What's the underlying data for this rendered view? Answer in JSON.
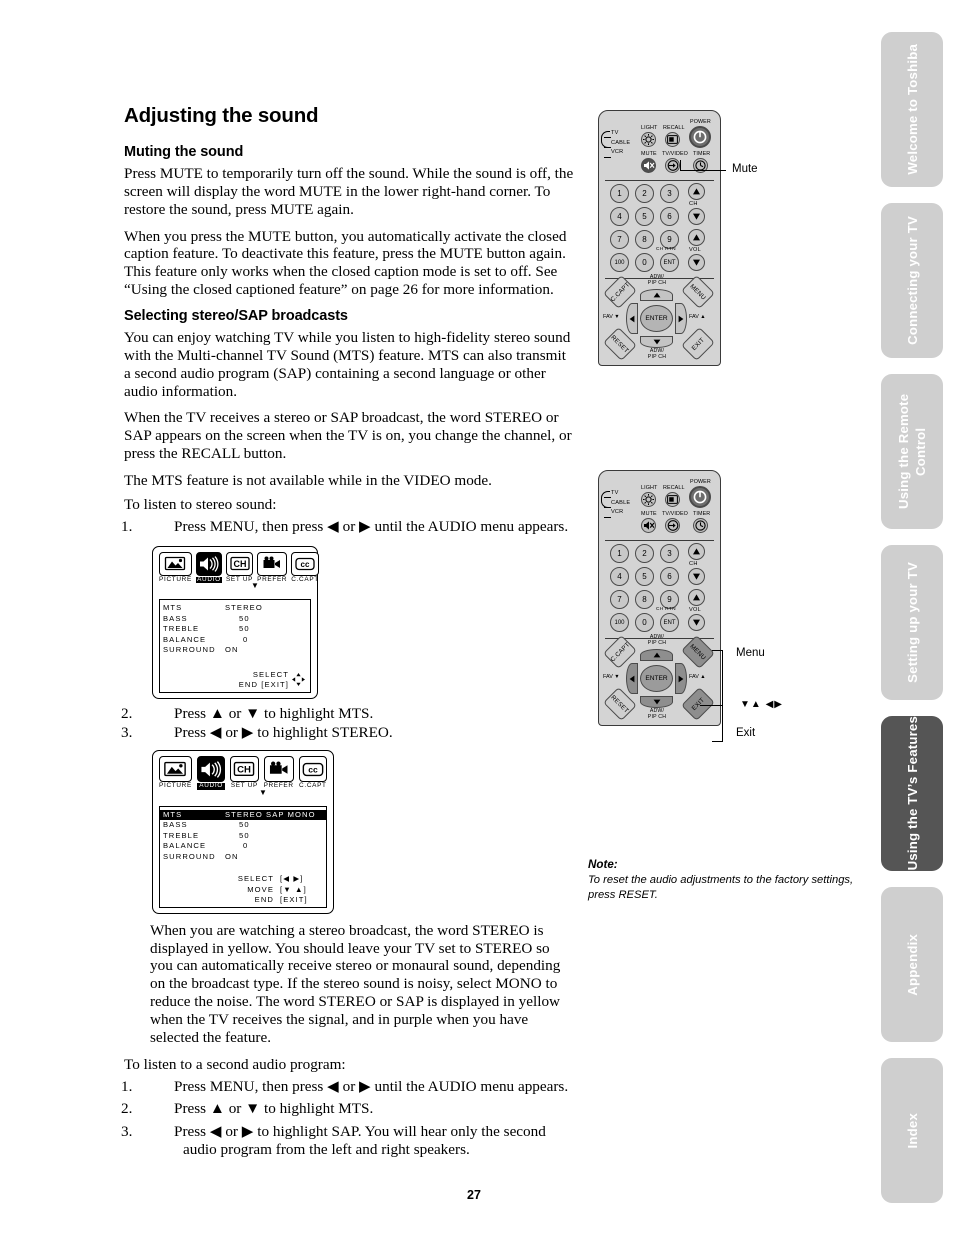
{
  "document": {
    "page_number": "27",
    "title": "Adjusting the sound"
  },
  "sections": [
    {
      "heading": "Muting the sound",
      "paragraphs": [
        "Press MUTE to temporarily turn off the sound. While the sound is off, the screen will display the word MUTE in the lower right-hand corner. To restore the sound, press MUTE again.",
        "When you press the MUTE button, you automatically activate the closed caption feature. To deactivate this feature, press the MUTE button again. This feature only works when the closed caption mode is set to off. See “Using the closed captioned feature” on page 26 for more information."
      ]
    },
    {
      "heading": "Selecting stereo/SAP broadcasts",
      "paragraphs": [
        "You can enjoy watching TV while you listen to high-fidelity stereo sound with the Multi-channel TV Sound (MTS) feature. MTS can also transmit a second audio program (SAP) containing a second language or other audio information.",
        "When the TV receives a stereo or SAP broadcast, the word STEREO or SAP appears on the screen when the TV is on, you change the channel, or press the RECALL button.",
        "The MTS feature is not available while in the VIDEO mode.",
        "To listen to stereo sound:"
      ]
    }
  ],
  "steps_stereo": [
    {
      "num": "1.",
      "text": "Press MENU, then press ◀ or ▶ until the AUDIO menu appears."
    },
    {
      "num": "2.",
      "text": "Press ▲ or ▼ to highlight MTS."
    },
    {
      "num": "3.",
      "text": "Press ◀ or ▶ to highlight STEREO."
    }
  ],
  "paragraph_stereo_note": "When you are watching a stereo broadcast, the word STEREO is displayed in yellow. You should leave your TV set to STEREO so you can automatically receive stereo or monaural sound, depending on the broadcast type. If the stereo sound is noisy, select MONO to reduce the noise. The word STEREO or SAP is displayed in yellow when the TV receives the signal, and in purple when you have selected the feature.",
  "lead_sap": "To listen to a second audio program:",
  "steps_sap": [
    {
      "num": "1.",
      "text": "Press MENU, then press ◀ or ▶ until the AUDIO menu appears."
    },
    {
      "num": "2.",
      "text": "Press ▲ or ▼ to highlight MTS."
    },
    {
      "num": "3.",
      "text": "Press ◀ or ▶ to highlight SAP. You will hear only the second audio program from the left and right speakers."
    }
  ],
  "tv_menu_1": {
    "tabs": [
      {
        "label": "PICTURE",
        "icon": "picture-icon",
        "glyph": "⛰",
        "selected": false
      },
      {
        "label": "AUDIO",
        "icon": "speaker-icon",
        "glyph": "◂)))",
        "selected": true
      },
      {
        "label": "SET UP",
        "icon": "channel-icon",
        "glyph": "CH",
        "selected": false
      },
      {
        "label": "PREFER",
        "icon": "camera-icon",
        "glyph": "▣",
        "selected": false
      },
      {
        "label": "C.CAPT",
        "icon": "closed-caption-icon",
        "glyph": "CC",
        "selected": false
      }
    ],
    "rows": [
      {
        "key": "MTS",
        "value": "STEREO",
        "highlighted": false
      },
      {
        "key": "BASS",
        "value": "50",
        "highlighted": false
      },
      {
        "key": "TREBLE",
        "value": "50",
        "highlighted": false
      },
      {
        "key": "BALANCE",
        "value": "0",
        "highlighted": false
      },
      {
        "key": "SURROUND",
        "value": "ON",
        "highlighted": false
      }
    ],
    "footer": [
      "SELECT",
      "END  [EXIT]"
    ]
  },
  "tv_menu_2": {
    "tabs": [
      {
        "label": "PICTURE",
        "icon": "picture-icon",
        "glyph": "⛰",
        "selected": false
      },
      {
        "label": "AUDIO",
        "icon": "speaker-icon",
        "glyph": "◂)))",
        "selected": true
      },
      {
        "label": "SET UP",
        "icon": "channel-icon",
        "glyph": "CH",
        "selected": false
      },
      {
        "label": "PREFER",
        "icon": "camera-icon",
        "glyph": "▣",
        "selected": false
      },
      {
        "label": "C.CAPT",
        "icon": "closed-caption-icon",
        "glyph": "CC",
        "selected": false
      }
    ],
    "rows": [
      {
        "key": "MTS",
        "value": "STEREO  SAP   MONO",
        "highlighted": true
      },
      {
        "key": "BASS",
        "value": "50",
        "highlighted": false
      },
      {
        "key": "TREBLE",
        "value": "50",
        "highlighted": false
      },
      {
        "key": "BALANCE",
        "value": "0",
        "highlighted": false
      },
      {
        "key": "SURROUND",
        "value": "ON",
        "highlighted": false
      }
    ],
    "footer_rows": [
      {
        "label": "SELECT",
        "keys": "[◀  ▶]"
      },
      {
        "label": "MOVE",
        "keys": "[▼  ▲]"
      },
      {
        "label": "END",
        "keys": "[EXIT]"
      }
    ]
  },
  "remote": {
    "modes": [
      "TV",
      "CABLE",
      "VCR"
    ],
    "top_labels": [
      "LIGHT",
      "RECALL",
      "POWER",
      "MUTE",
      "TV/VIDEO",
      "TIMER"
    ],
    "numbers": [
      "1",
      "2",
      "3",
      "4",
      "5",
      "6",
      "7",
      "8",
      "9",
      "100",
      "0",
      "ENT"
    ],
    "ch_label": "CH",
    "vol_label": "VOL",
    "chrtn_label": "CH RTN",
    "dpad": {
      "enter": "ENTER",
      "ccapt": "C.CAPT",
      "menu": "MENU",
      "reset": "RESET",
      "exit": "EXIT",
      "adw_pip_top": "ADW/\nPIP CH",
      "adw_pip_bottom": "ADW/\nPIP CH",
      "fav_down": "FAV ▼",
      "fav_up": "FAV ▲"
    }
  },
  "callouts": {
    "mute": "Mute",
    "menu": "Menu",
    "arrows": "▼▲ ◀▶",
    "exit": "Exit"
  },
  "note": {
    "title": "Note:",
    "body": "To reset the audio adjustments to the factory settings, press RESET."
  },
  "sidebar_tabs": [
    {
      "label": "Welcome to Toshiba",
      "active": false
    },
    {
      "label": "Connecting your TV",
      "active": false
    },
    {
      "label": "Using the Remote Control",
      "active": false
    },
    {
      "label": "Setting up your TV",
      "active": false
    },
    {
      "label": "Using the TV’s Features",
      "active": true
    },
    {
      "label": "Appendix",
      "active": false
    },
    {
      "label": "Index",
      "active": false
    }
  ],
  "colors": {
    "tab_inactive": "#cfcfcf",
    "tab_active": "#555555",
    "remote_body": "#d4d4d4",
    "highlight": "#8e8e8e"
  }
}
